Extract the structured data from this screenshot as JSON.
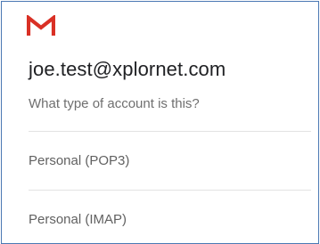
{
  "header": {
    "logo_icon": "gmail-m-logo-icon",
    "logo_colors": [
      "#d93025",
      "#b31412"
    ]
  },
  "account": {
    "email": "joe.test@xplornet.com",
    "prompt": "What type of account is this?"
  },
  "options": [
    {
      "label": "Personal (POP3)"
    },
    {
      "label": "Personal (IMAP)"
    }
  ]
}
